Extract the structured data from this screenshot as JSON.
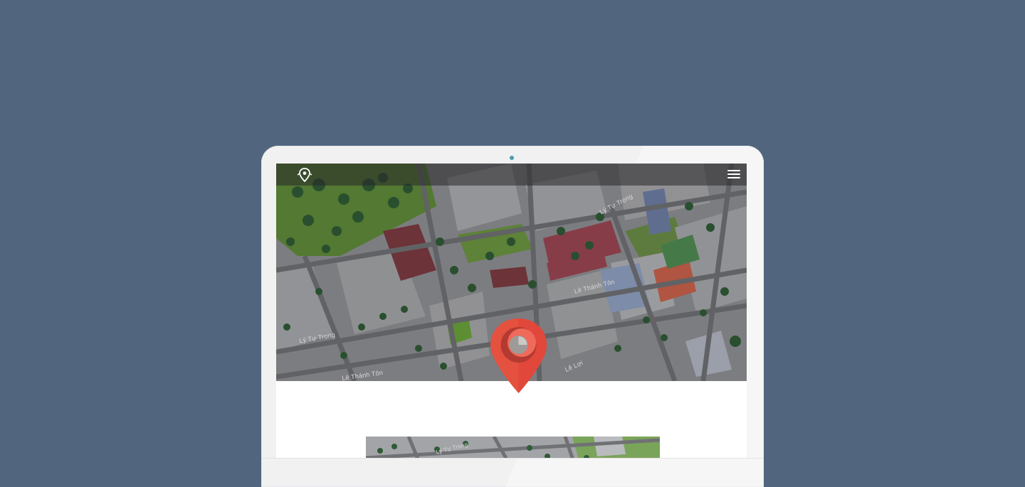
{
  "navbar": {
    "logo_icon": "map-pin-logo-icon",
    "menu_icon": "hamburger-menu-icon"
  },
  "map": {
    "streets": [
      "Lý Tự Trọng",
      "Lê Thánh Tôn",
      "Lê Lợi",
      "Lý Tự Trọng",
      "Lê Thánh Tôn"
    ],
    "marker_icon": "location-pin-icon",
    "marker_color": "#e5513f"
  },
  "thumbnail": {
    "streets": [
      "Lý Tự Trọng"
    ]
  },
  "colors": {
    "background": "#51657e",
    "laptop_frame": "#f1f1f1",
    "camera": "#4c9bb3"
  }
}
